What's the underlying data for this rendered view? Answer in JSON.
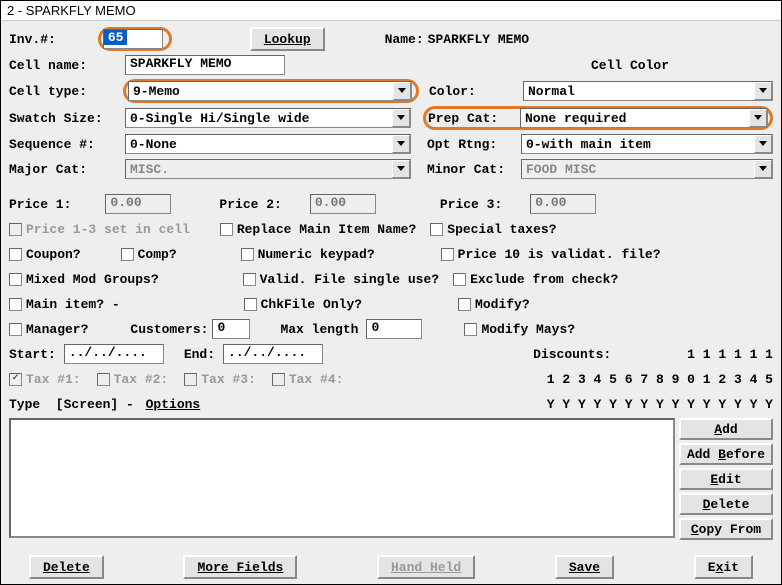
{
  "title": "2 - SPARKFLY MEMO",
  "header": {
    "inv_label": "Inv.#:",
    "inv_value": "65",
    "lookup": "Lookup",
    "name_label": "Name:",
    "name_value": "SPARKFLY MEMO",
    "cellname_label": "Cell name:",
    "cellname_value": "SPARKFLY MEMO",
    "cellcolor_label": "Cell Color",
    "celltype_label": "Cell type:",
    "celltype_value": "9-Memo",
    "color_label": "Color:",
    "color_value": "Normal",
    "swatch_label": "Swatch Size:",
    "swatch_value": "0-Single Hi/Single wide",
    "prepcat_label": "Prep Cat:",
    "prepcat_value": "None required",
    "seq_label": "Sequence #:",
    "seq_value": "0-None",
    "optrtng_label": "Opt Rtng:",
    "optrtng_value": "0-with main item",
    "majorcat_label": "Major Cat:",
    "majorcat_value": "MISC.",
    "minorcat_label": "Minor Cat:",
    "minorcat_value": "FOOD MISC"
  },
  "prices": {
    "p1_label": "Price 1:",
    "p1_value": "0.00",
    "p2_label": "Price 2:",
    "p2_value": "0.00",
    "p3_label": "Price 3:",
    "p3_value": "0.00"
  },
  "checks": {
    "price13": "Price 1-3 set in cell",
    "replace": "Replace Main Item Name?",
    "special": "Special taxes?",
    "coupon": "Coupon?",
    "comp": "Comp?",
    "numpad": "Numeric keypad?",
    "price10": "Price 10 is validat. file?",
    "mixed": "Mixed Mod Groups?",
    "valid": "Valid. File single use?",
    "exclude": "Exclude from check?",
    "mainitem": "Main item? -",
    "chkfile": "ChkFile Only?",
    "modify": "Modify?",
    "manager": "Manager?",
    "customers_label": "Customers:",
    "customers_value": "0",
    "maxlen_label": "Max length",
    "maxlen_value": "0",
    "modmays": "Modify Mays?"
  },
  "dates": {
    "start_label": "Start:",
    "start_value": "../../....",
    "end_label": "End:",
    "end_value": "../../....",
    "discounts_label": "Discounts:",
    "disc_top": "1 1 1 1 1 1"
  },
  "tax": {
    "t1": "Tax #1:",
    "t2": "Tax #2:",
    "t3": "Tax #3:",
    "t4": "Tax #4:",
    "nums": "1 2 3 4 5 6 7 8 9 0 1 2 3 4 5"
  },
  "type_line": {
    "pre": "Type  [Screen] - ",
    "opt": "Options",
    "ys": "Y Y Y Y Y Y Y Y Y Y Y Y Y Y Y"
  },
  "sidebtns": {
    "add": "Add",
    "addbefore": "Add Before",
    "edit": "Edit",
    "delete": "Delete",
    "copyfrom": "Copy From"
  },
  "bottom": {
    "delete": "Delete",
    "more": "More Fields",
    "hand": "Hand Held",
    "save": "Save",
    "exit": "Exit"
  }
}
